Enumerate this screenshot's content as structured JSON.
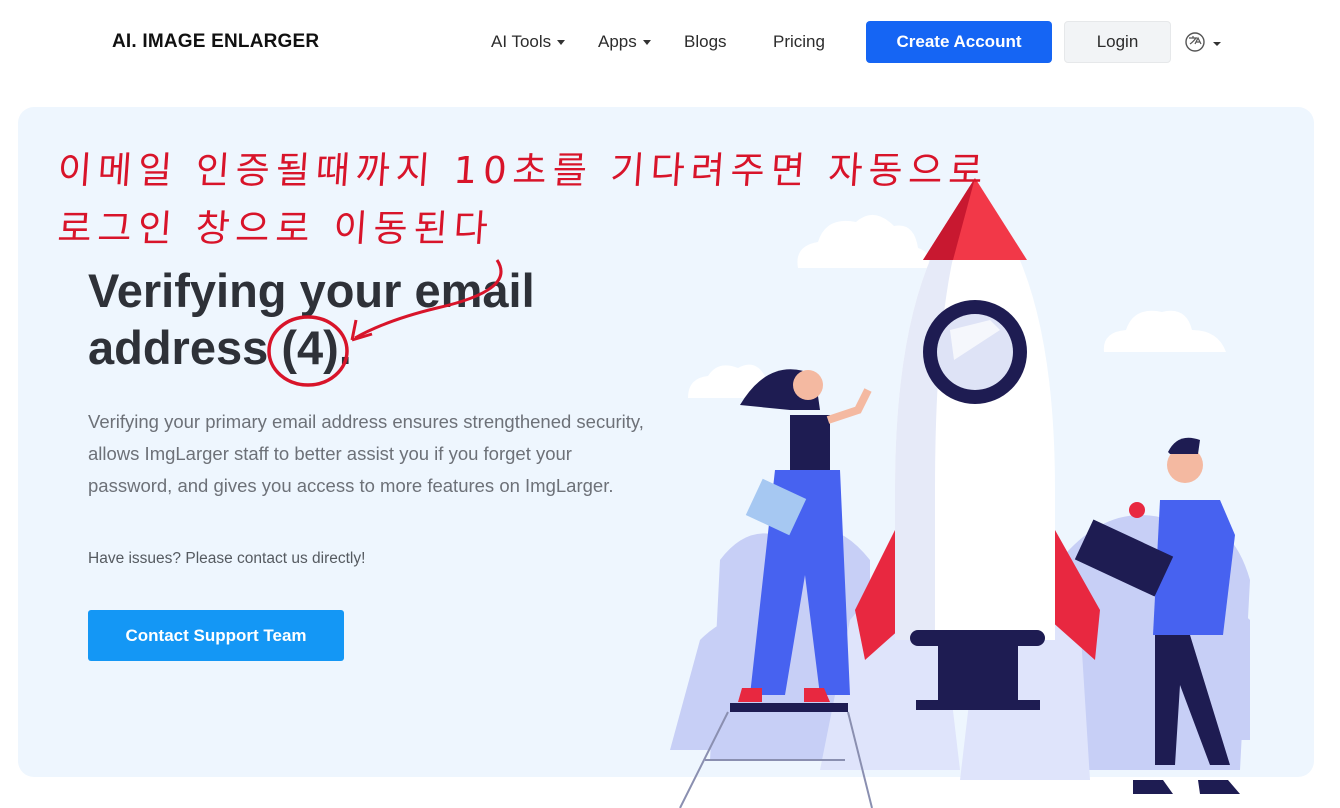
{
  "header": {
    "brand": "AI. IMAGE ENLARGER",
    "nav": {
      "ai_tools": "AI Tools",
      "apps": "Apps",
      "blogs": "Blogs",
      "pricing": "Pricing"
    },
    "create_account": "Create Account",
    "login": "Login",
    "language_icon": "translate-icon"
  },
  "annotation": {
    "line1": "이메일 인증될때까지 10초를 기다려주면 자동으로",
    "line2": "로그인 창으로 이동된다",
    "color": "#d8142a"
  },
  "main": {
    "title_line1": "Verifying your email",
    "title_line2_prefix": "address ",
    "countdown": "(4)",
    "title_line2_suffix": ".",
    "description": "Verifying your primary email address ensures strengthened security, allows ImgLarger staff to better assist you if you forget your password, and gives you access to more features on ImgLarger.",
    "issues": "Have issues? Please contact us directly!",
    "support_button": "Contact Support Team"
  },
  "colors": {
    "primary": "#1565f4",
    "support": "#1497f5",
    "hero_bg": "#eef6fe"
  }
}
